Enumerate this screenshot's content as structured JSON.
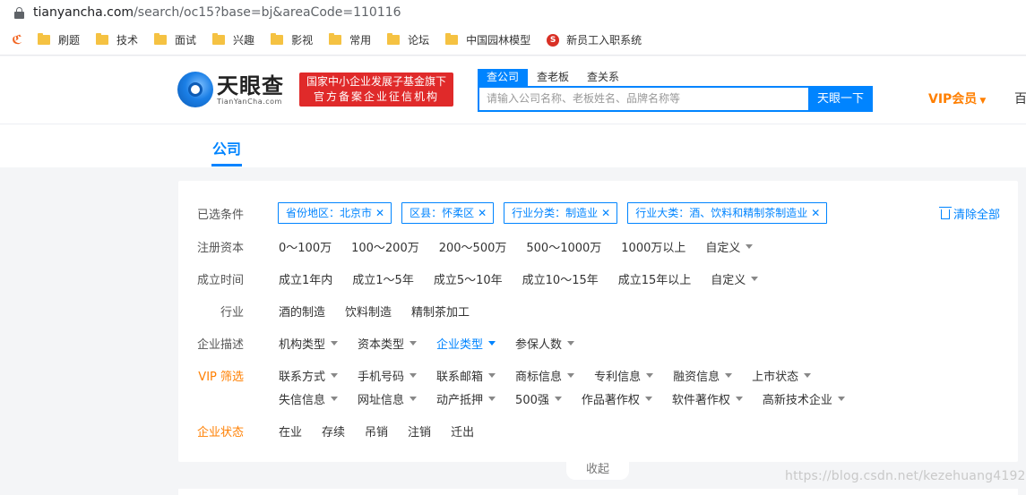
{
  "browser": {
    "url_host": "tianyancha.com",
    "url_path": "/search/oc15?base=bj&areaCode=110116",
    "bookmarks": [
      {
        "label": "刷题",
        "icon": "folder-icon"
      },
      {
        "label": "技术",
        "icon": "folder-icon"
      },
      {
        "label": "面试",
        "icon": "folder-icon"
      },
      {
        "label": "兴趣",
        "icon": "folder-icon"
      },
      {
        "label": "影视",
        "icon": "folder-icon"
      },
      {
        "label": "常用",
        "icon": "folder-icon"
      },
      {
        "label": "论坛",
        "icon": "folder-icon"
      },
      {
        "label": "中国园林模型",
        "icon": "folder-icon"
      },
      {
        "label": "新员工入职系统",
        "icon": "site-icon"
      }
    ]
  },
  "header": {
    "logo_cn": "天眼查",
    "logo_en": "TianYanCha.com",
    "badge_line1": "国家中小企业发展子基金旗下",
    "badge_line2": "官方备案企业征信机构",
    "search_tabs": [
      "查公司",
      "查老板",
      "查关系"
    ],
    "search_placeholder": "请输入公司名称、老板姓名、品牌名称等",
    "search_button": "天眼一下",
    "vip": "VIP会员",
    "partial": "百"
  },
  "nav": {
    "active_tab": "公司"
  },
  "filters": {
    "selected_label": "已选条件",
    "selected_chips": [
      "省份地区：北京市",
      "区县：怀柔区",
      "行业分类：制造业",
      "行业大类：酒、饮料和精制茶制造业"
    ],
    "clear_all": "清除全部",
    "capital_label": "注册资本",
    "capital_options": [
      "0～100万",
      "100～200万",
      "200～500万",
      "500～1000万",
      "1000万以上"
    ],
    "capital_custom": "自定义",
    "founded_label": "成立时间",
    "founded_options": [
      "成立1年内",
      "成立1～5年",
      "成立5～10年",
      "成立10～15年",
      "成立15年以上"
    ],
    "founded_custom": "自定义",
    "industry_label": "行业",
    "industry_options": [
      "酒的制造",
      "饮料制造",
      "精制茶加工"
    ],
    "desc_label": "企业描述",
    "desc_options": [
      "机构类型",
      "资本类型",
      "企业类型",
      "参保人数"
    ],
    "vip_label": "VIP 筛选",
    "vip_row1": [
      "联系方式",
      "手机号码",
      "联系邮箱",
      "商标信息",
      "专利信息",
      "融资信息",
      "上市状态"
    ],
    "vip_row2": [
      "失信信息",
      "网址信息",
      "动产抵押",
      "500强",
      "作品著作权",
      "软件著作权",
      "高新技术企业"
    ],
    "status_label": "企业状态",
    "status_options": [
      "在业",
      "存续",
      "吊销",
      "注销",
      "迁出"
    ],
    "collapse": "收起"
  },
  "watermark": "https://blog.csdn.net/kezehuang4192"
}
